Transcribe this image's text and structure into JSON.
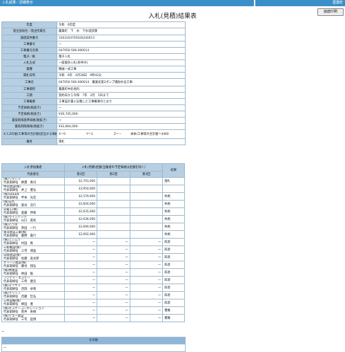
{
  "header": {
    "breadcrumb": "入札結果／詳細表示",
    "right_label": "農業町",
    "print_button": "画面印刷"
  },
  "title": "入札(見積)結果表",
  "info": [
    {
      "label": "年度",
      "value": "令和　6年度"
    },
    {
      "label": "発注部局名／発注所属名",
      "value": "農業町　下　水　下水道部課"
    },
    {
      "label": "調達案件番号",
      "value": "3303104705020240013"
    },
    {
      "label": "工事番号",
      "value": "一"
    },
    {
      "label": "工事番号名称",
      "value": "047050-506-000014"
    },
    {
      "label": "電子／紙",
      "value": "電子入札"
    },
    {
      "label": "入札方式",
      "value": "一般競争入札(条件付)"
    },
    {
      "label": "業種",
      "value": "機械一式工事"
    },
    {
      "label": "開札日時",
      "value": "令和　6年　6月28日　9時42分"
    },
    {
      "label": "工事名",
      "value": "047050-506-000014　農業北第2ポンプ場耐水化工事"
    },
    {
      "label": "工事場所",
      "value": "農業町中北地内"
    },
    {
      "label": "工期",
      "value": "契約日から令和　7年　2月　5日まで"
    },
    {
      "label": "工事概要",
      "value": "工事設計書に記載した工事概要のとおり"
    },
    {
      "label": "予定価格(税抜き)",
      "value": "一"
    },
    {
      "label": "予定価格(税抜き)",
      "value": "¥30,745,000-"
    },
    {
      "label": "最低制限基準価格(税抜き)",
      "value": "一"
    },
    {
      "label": "最低制限価格(税抜き)",
      "value": "¥32,664,000-"
    },
    {
      "label": "X,Y,Zの値(工事等の合計額(該当する価格の比率))",
      "x": "X＝0",
      "y": "Y＝3",
      "z": "Z＝－",
      "extra": "本体(工事等の合計額＝4460"
    },
    {
      "label": "備考",
      "value": "落札"
    }
  ],
  "results": {
    "header_company": "入札参加業者",
    "header_amount": "入札(見積)金額(当業者の予定価格は金額を除く)",
    "header_judgement": "結果",
    "sub_company": "代表者名",
    "sub_rounds": [
      "第1回",
      "第2回",
      "第3回"
    ],
    "rows": [
      {
        "company": "(株)ワタシマ",
        "rep": "代表取締役　綿貫　真司",
        "r1": "32,701,000",
        "r2": "",
        "r3": "",
        "result": "落札"
      },
      {
        "company": "中央建設(株)",
        "rep": "代表取締役　井上　豊弘",
        "r1": "33,950,000",
        "r2": "",
        "r3": "",
        "result": ""
      },
      {
        "company": "(株)GREEN",
        "rep": "代表取締役　甲本　光宏",
        "r1": "32,579,000",
        "r2": "",
        "r3": "",
        "result": "失格"
      },
      {
        "company": "(株)日九",
        "rep": "代表取締役　富谷　浩行",
        "r1": "32,604,000",
        "r2": "",
        "r3": "",
        "result": "失格"
      },
      {
        "company": "日電工(株)",
        "rep": "代表取締役　進藤　伸和",
        "r1": "32,635,000",
        "r2": "",
        "r3": "",
        "result": "失格"
      },
      {
        "company": "(株)ウインテック",
        "rep": "代表取締役　山口　進利",
        "r1": "32,636,000",
        "r2": "",
        "r3": "",
        "result": "失格"
      },
      {
        "company": "(株)ハラダ",
        "rep": "代表取締役　原田　一行",
        "r1": "32,690,000",
        "r2": "",
        "r3": "",
        "result": "失格"
      },
      {
        "company": "東洋建設工業(株)",
        "rep": "代表取締役　藤野　貴行",
        "r1": "32,692,000",
        "r2": "",
        "r3": "",
        "result": "失格"
      },
      {
        "company": "(株)ニシムラ",
        "rep": "代表取締役　村田　真",
        "r1": "一",
        "r2": "一",
        "r3": "一",
        "result": "辞退"
      },
      {
        "company": "三和機設(株)",
        "rep": "代表取締役　三宅　博晶",
        "r1": "一",
        "r2": "一",
        "r3": "一",
        "result": "辞退"
      },
      {
        "company": "日興建設(株)",
        "rep": "代表取締役　佐藤　直太郎",
        "r1": "一",
        "r2": "一",
        "r3": "一",
        "result": "辞退"
      },
      {
        "company": "グリーン建設(株)",
        "rep": "代表取締役　藤谷　翔弘",
        "r1": "一",
        "r2": "一",
        "r3": "一",
        "result": "辞退"
      },
      {
        "company": "(株)林建設",
        "rep": "代表取締役　林田　聡",
        "r1": "一",
        "r2": "一",
        "r3": "一",
        "result": "辞退"
      },
      {
        "company": "フジテイ・エスピー",
        "rep": "代表取締役　三村　健吾",
        "r1": "一",
        "r2": "一",
        "r3": "一",
        "result": "辞退"
      },
      {
        "company": "(株)ミツヤマ",
        "rep": "代表取締役　西岡　卓和",
        "r1": "一",
        "r2": "一",
        "r3": "一",
        "result": "辞退"
      },
      {
        "company": "(株)クリップ",
        "rep": "代表取締役　西藤　哲弘",
        "r1": "一",
        "r2": "一",
        "r3": "一",
        "result": "辞退"
      },
      {
        "company": "三井設備(株)",
        "rep": "代表取締役　柳田　豊",
        "r1": "一",
        "r2": "一",
        "r3": "一",
        "result": "辞退"
      },
      {
        "company": "(株)エスケーコーポレーション",
        "rep": "代表取締役　菅井　寿樹",
        "r1": "一",
        "r2": "一",
        "r3": "一",
        "result": "棄権"
      },
      {
        "company": "(株)テエー建設",
        "rep": "代表取締役　三宅　田博",
        "r1": "一",
        "r2": "一",
        "r3": "一",
        "result": "棄権"
      }
    ]
  },
  "footer_dash": "一",
  "other": {
    "title": "その他",
    "value": "一"
  }
}
